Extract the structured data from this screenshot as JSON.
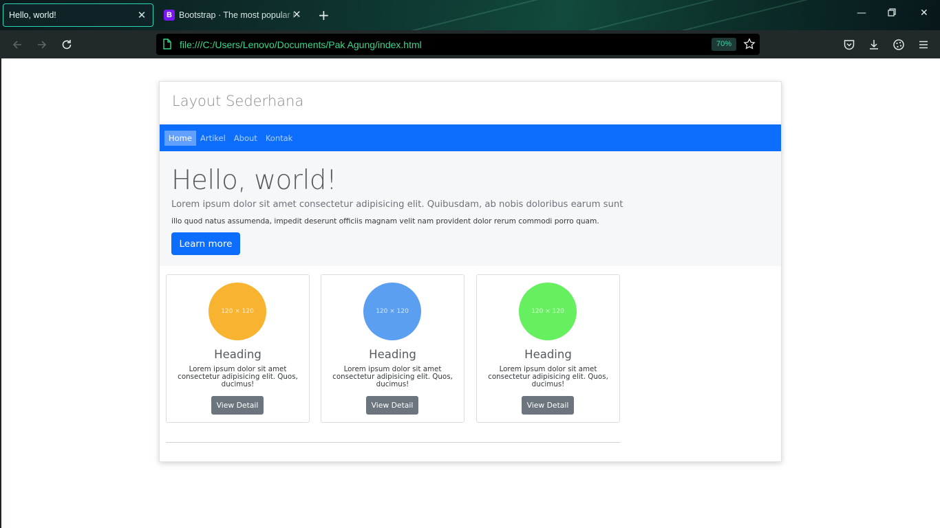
{
  "browser": {
    "tabs": [
      {
        "title": "Hello, world!",
        "active": true
      },
      {
        "title": "Bootstrap · The most popular HTML, CSS, and JS library in the world.",
        "favicon": "B",
        "active": false
      }
    ],
    "url": "file:///C:/Users/Lenovo/Documents/Pak Agung/index.html",
    "zoom": "70%",
    "icons": [
      "back-icon",
      "forward-icon",
      "reload-icon",
      "page-icon",
      "bookmark-star-icon",
      "pocket-icon",
      "downloads-icon",
      "extensions-icon",
      "menu-icon",
      "new-tab-icon",
      "minimize-icon",
      "restore-icon",
      "close-window-icon"
    ]
  },
  "page": {
    "site_title": "Layout Sederhana",
    "nav": [
      {
        "label": "Home",
        "active": true
      },
      {
        "label": "Artikel",
        "active": false
      },
      {
        "label": "About",
        "active": false
      },
      {
        "label": "Kontak",
        "active": false
      }
    ],
    "jumbotron": {
      "heading": "Hello, world!",
      "lead": "Lorem ipsum dolor sit amet consectetur adipisicing elit. Quibusdam, ab nobis doloribus earum sunt",
      "text": "illo quod natus assumenda, impedit deserunt officiis magnam velit nam provident dolor rerum commodi porro quam.",
      "button": "Learn more"
    },
    "cards": [
      {
        "image_label": "120 × 120",
        "color": "#f8b431",
        "heading": "Heading",
        "text": "Lorem ipsum dolor sit amet consectetur adipisicing elit. Quos, ducimus!",
        "button": "View Detail"
      },
      {
        "image_label": "120 × 120",
        "color": "#5a9ff0",
        "heading": "Heading",
        "text": "Lorem ipsum dolor sit amet consectetur adipisicing elit. Quos, ducimus!",
        "button": "View Detail"
      },
      {
        "image_label": "120 × 120",
        "color": "#66ef5e",
        "heading": "Heading",
        "text": "Lorem ipsum dolor sit amet consectetur adipisicing elit. Quos, ducimus!",
        "button": "View Detail"
      }
    ]
  },
  "colors": {
    "accent": "#2cd7b8",
    "url_text": "#38d98f",
    "nav_bg": "#0d6efd",
    "primary_button": "#0d6efd",
    "secondary_button": "#6c757d"
  }
}
